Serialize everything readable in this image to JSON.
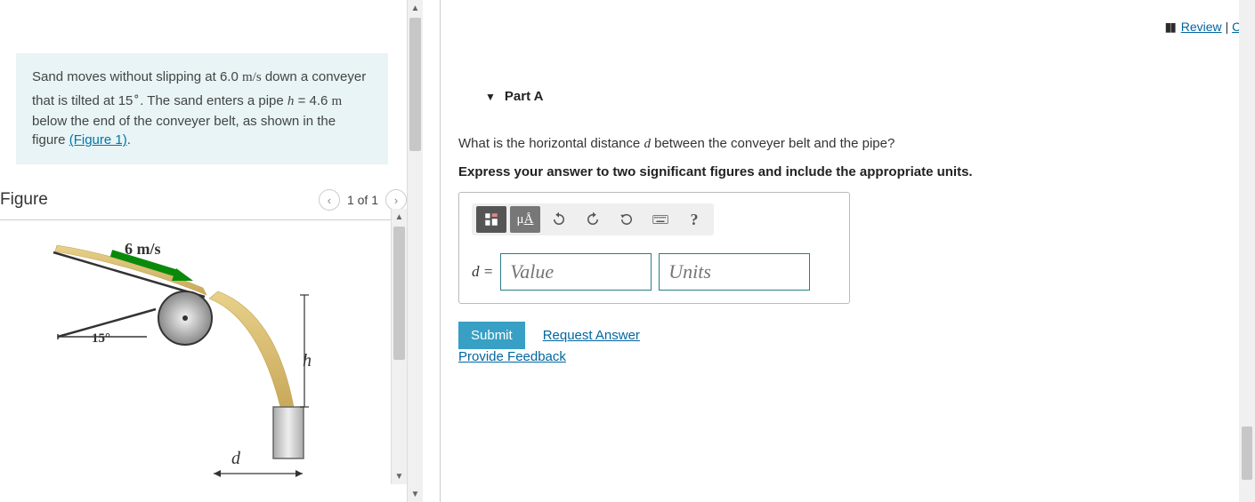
{
  "top_links": {
    "review": "Review",
    "co": "Co"
  },
  "problem": {
    "text1": "Sand moves without slipping at 6.0 ",
    "speed_unit": "m/s",
    "text2": " down a conveyer that is tilted at 15",
    "deg": "∘",
    "text3": ". The sand enters a pipe ",
    "h_var": "h",
    "text4": " = 4.6 ",
    "m_unit": "m",
    "text5": " below the end of the conveyer belt, as shown in the figure ",
    "figlink": "(Figure 1)",
    "period": "."
  },
  "figure": {
    "title": "Figure",
    "pager": "1 of 1",
    "label_speed": "6 m/s",
    "label_angle": "15°",
    "label_h": "h",
    "label_d": "d"
  },
  "part": {
    "label": "Part A",
    "caret": "▼"
  },
  "question": {
    "t1": "What is the horizontal distance ",
    "dvar": "d",
    "t2": " between the conveyer belt and the pipe?"
  },
  "instruction": "Express your answer to two significant figures and include the appropriate units.",
  "toolbar": {
    "mua": "μÅ",
    "help": "?"
  },
  "entry": {
    "label": "d = ",
    "value_ph": "Value",
    "units_ph": "Units"
  },
  "submit": {
    "btn": "Submit",
    "request": "Request Answer"
  },
  "feedback": "Provide Feedback"
}
